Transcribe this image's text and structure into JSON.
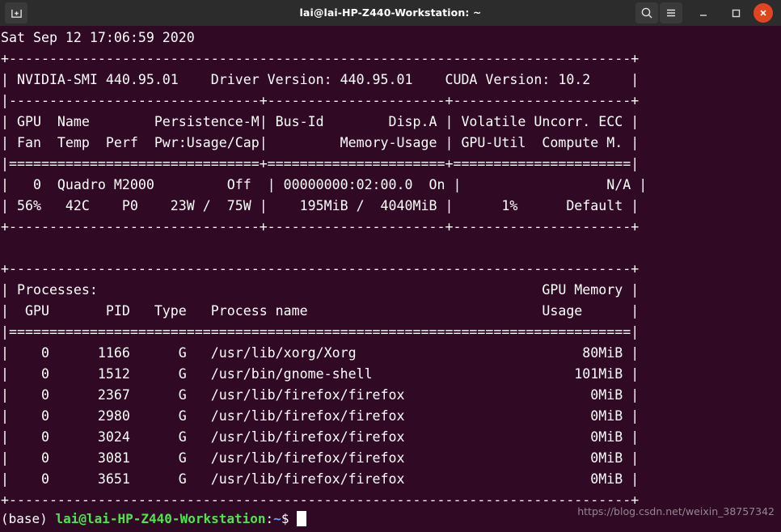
{
  "window": {
    "title": "lai@lai-HP-Z440-Workstation: ~",
    "new_tab_icon": "new-tab-icon",
    "search_icon": "search-icon",
    "menu_icon": "hamburger-menu-icon",
    "minimize_icon": "minimize-icon",
    "maximize_icon": "maximize-icon",
    "close_icon": "close-icon",
    "titlebar_bg": "#2c2c2c",
    "close_bg": "#e0451f"
  },
  "terminal": {
    "bg": "#300a24",
    "fg": "#ffffff",
    "prompt_user_color": "#4ee44e",
    "prompt_path_color": "#6a9fff",
    "lines": [
      "Sat Sep 12 17:06:59 2020",
      "+-----------------------------------------------------------------------------+",
      "| NVIDIA-SMI 440.95.01    Driver Version: 440.95.01    CUDA Version: 10.2     |",
      "|-------------------------------+----------------------+----------------------+",
      "| GPU  Name        Persistence-M| Bus-Id        Disp.A | Volatile Uncorr. ECC |",
      "| Fan  Temp  Perf  Pwr:Usage/Cap|         Memory-Usage | GPU-Util  Compute M. |",
      "|===============================+======================+======================|",
      "|   0  Quadro M2000         Off  | 00000000:02:00.0  On |                  N/A |",
      "| 56%   42C    P0    23W /  75W |    195MiB /  4040MiB |      1%      Default |",
      "+-------------------------------+----------------------+----------------------+",
      "",
      "+-----------------------------------------------------------------------------+",
      "| Processes:                                                       GPU Memory |",
      "|  GPU       PID   Type   Process name                             Usage      |",
      "|=============================================================================|",
      "|    0      1166      G   /usr/lib/xorg/Xorg                            80MiB |",
      "|    0      1512      G   /usr/bin/gnome-shell                         101MiB |",
      "|    0      2367      G   /usr/lib/firefox/firefox                       0MiB |",
      "|    0      2980      G   /usr/lib/firefox/firefox                       0MiB |",
      "|    0      3024      G   /usr/lib/firefox/firefox                       0MiB |",
      "|    0      3081      G   /usr/lib/firefox/firefox                       0MiB |",
      "|    0      3651      G   /usr/lib/firefox/firefox                       0MiB |",
      "+-----------------------------------------------------------------------------+"
    ],
    "prompt": {
      "env": "(base) ",
      "userhost": "lai@lai-HP-Z440-Workstation",
      "colon": ":",
      "path": "~",
      "sigil": "$",
      "space": " ",
      "cursor": " "
    }
  },
  "watermark": {
    "text": "https://blog.csdn.net/weixin_38757342"
  }
}
